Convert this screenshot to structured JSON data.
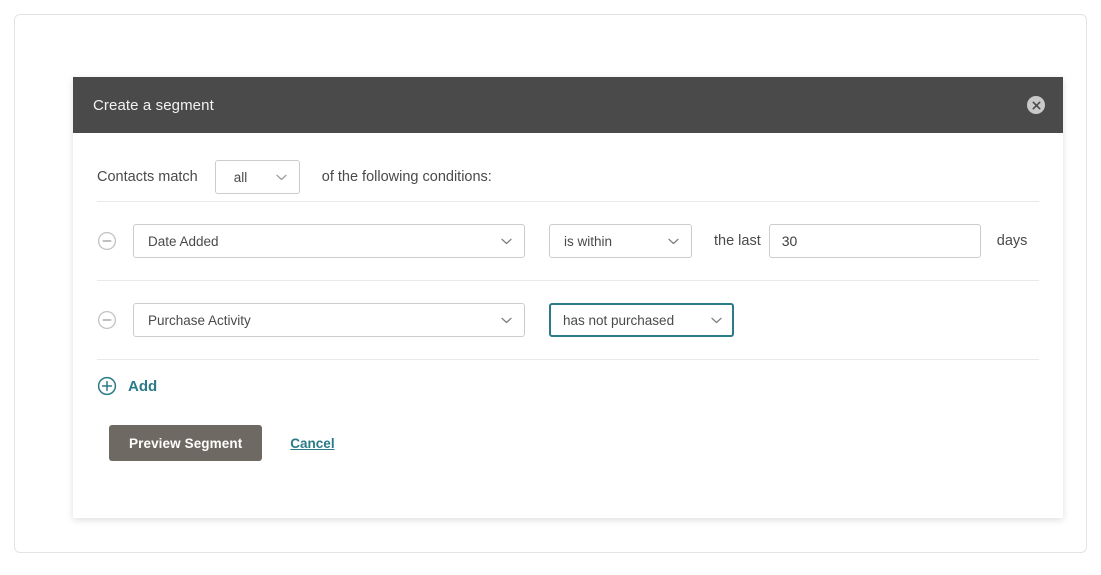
{
  "modal": {
    "title": "Create a segment",
    "close_icon": "close-icon",
    "match_row": {
      "prefix_label": "Contacts match",
      "match_value": "all",
      "suffix_label": "of the following conditions:"
    },
    "conditions": [
      {
        "remove_icon": "minus-circle-icon",
        "field": "Date Added",
        "operator": "is within",
        "operator_focused": false,
        "mid_label": "the last",
        "value": "30",
        "unit_label": "days",
        "has_value_input": true
      },
      {
        "remove_icon": "minus-circle-icon",
        "field": "Purchase Activity",
        "operator": "has not purchased",
        "operator_focused": true,
        "mid_label": "",
        "value": "",
        "unit_label": "",
        "has_value_input": false
      }
    ],
    "add": {
      "icon": "plus-circle-icon",
      "label": "Add"
    },
    "footer": {
      "primary_label": "Preview Segment",
      "cancel_label": "Cancel"
    }
  },
  "colors": {
    "header_bar": "#4a4a4a",
    "accent_teal": "#2a7a88",
    "primary_button": "#6e6962",
    "border": "#cccccc",
    "divider": "#e9e9e9"
  }
}
